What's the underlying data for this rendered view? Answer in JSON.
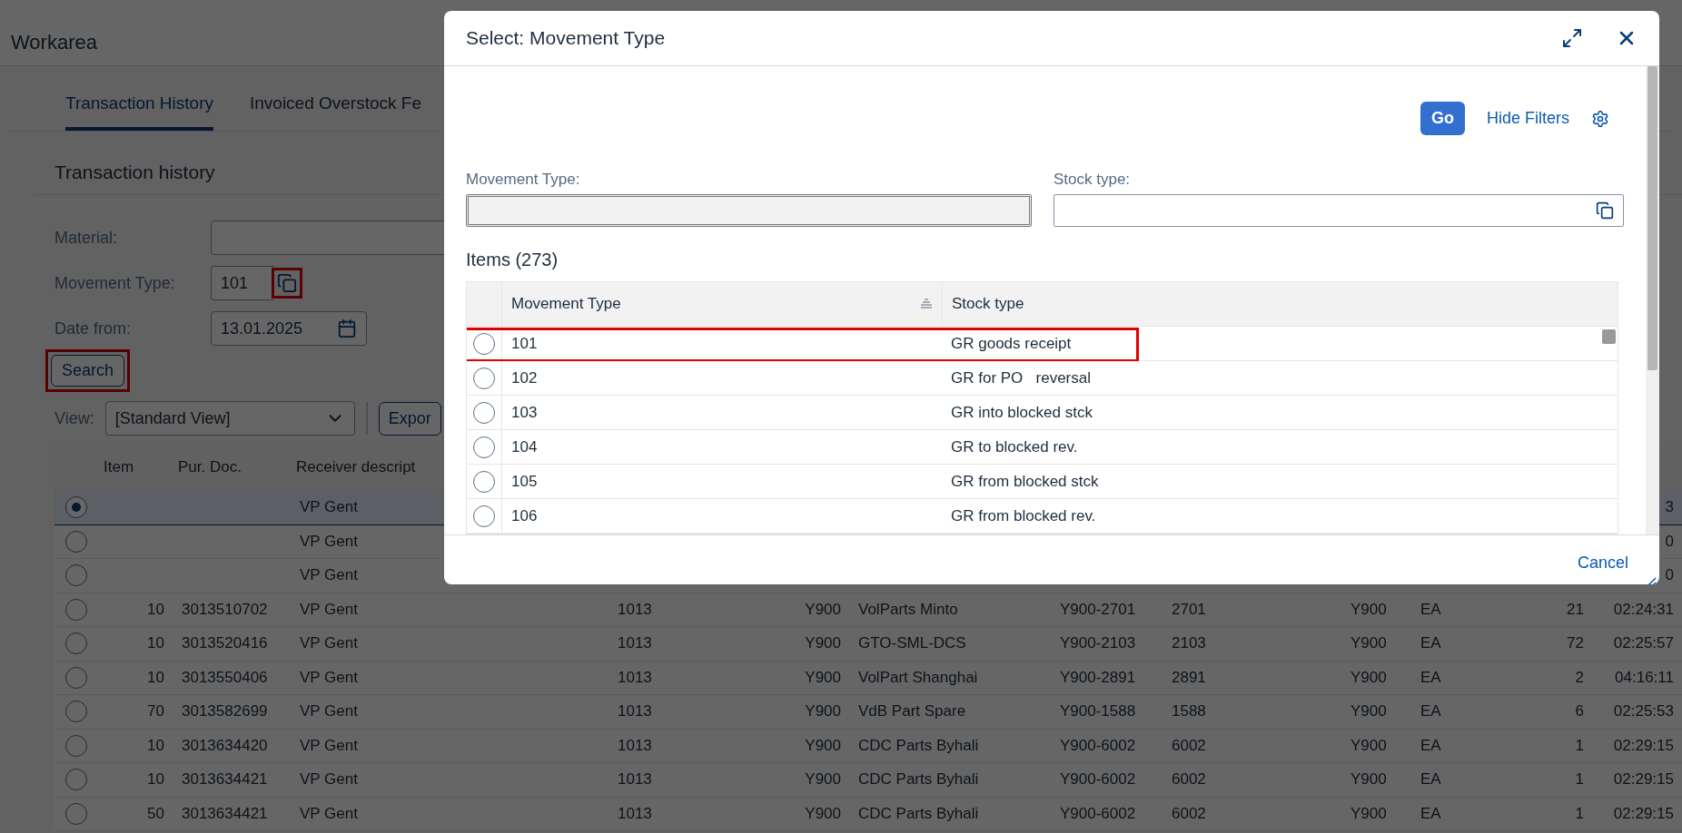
{
  "page": {
    "title": "Workarea"
  },
  "tabs": [
    {
      "label": "Transaction History",
      "selected": true
    },
    {
      "label": "Invoiced Overstock Fe",
      "selected": false
    }
  ],
  "section": {
    "title": "Transaction history"
  },
  "filters": {
    "material": {
      "label": "Material:"
    },
    "movement_type": {
      "label": "Movement Type:",
      "value": "101",
      "highlighted": true
    },
    "date_from": {
      "label": "Date from:",
      "value": "13.01.2025"
    }
  },
  "search_button": {
    "label": "Search",
    "highlighted": true
  },
  "view": {
    "label": "View:",
    "value": "[Standard View]"
  },
  "export_button": "Expor",
  "table": {
    "columns": [
      "Item",
      "Pur. Doc.",
      "Receiver descript"
    ],
    "rows": [
      {
        "selected": true,
        "receiver": "VP Gent",
        "column_12": "3"
      },
      {
        "selected": false,
        "receiver": "VP Gent",
        "column_12": "0"
      },
      {
        "selected": false,
        "receiver": "VP Gent",
        "column_12": "0"
      },
      {
        "selected": false,
        "item": "10",
        "pur_doc": "3013510702",
        "receiver": "VP Gent",
        "column_4": "1013",
        "column_5": "Y900",
        "column_6": "VolParts Minto",
        "column_7": "Y900-2701",
        "column_8": "2701",
        "column_9": "Y900",
        "column_10": "EA",
        "column_11": "21",
        "column_12": "02:24:31"
      },
      {
        "selected": false,
        "item": "10",
        "pur_doc": "3013520416",
        "receiver": "VP Gent",
        "column_4": "1013",
        "column_5": "Y900",
        "column_6": "GTO-SML-DCS",
        "column_7": "Y900-2103",
        "column_8": "2103",
        "column_9": "Y900",
        "column_10": "EA",
        "column_11": "72",
        "column_12": "02:25:57"
      },
      {
        "selected": false,
        "item": "10",
        "pur_doc": "3013550406",
        "receiver": "VP Gent",
        "column_4": "1013",
        "column_5": "Y900",
        "column_6": "VolPart Shanghai",
        "column_7": "Y900-2891",
        "column_8": "2891",
        "column_9": "Y900",
        "column_10": "EA",
        "column_11": "2",
        "column_12": "04:16:11"
      },
      {
        "selected": false,
        "item": "70",
        "pur_doc": "3013582699",
        "receiver": "VP Gent",
        "column_4": "1013",
        "column_5": "Y900",
        "column_6": "VdB Part Spare",
        "column_7": "Y900-1588",
        "column_8": "1588",
        "column_9": "Y900",
        "column_10": "EA",
        "column_11": "6",
        "column_12": "02:25:53"
      },
      {
        "selected": false,
        "item": "10",
        "pur_doc": "3013634420",
        "receiver": "VP Gent",
        "column_4": "1013",
        "column_5": "Y900",
        "column_6": "CDC Parts Byhali",
        "column_7": "Y900-6002",
        "column_8": "6002",
        "column_9": "Y900",
        "column_10": "EA",
        "column_11": "1",
        "column_12": "02:29:15"
      },
      {
        "selected": false,
        "item": "10",
        "pur_doc": "3013634421",
        "receiver": "VP Gent",
        "column_4": "1013",
        "column_5": "Y900",
        "column_6": "CDC Parts Byhali",
        "column_7": "Y900-6002",
        "column_8": "6002",
        "column_9": "Y900",
        "column_10": "EA",
        "column_11": "1",
        "column_12": "02:29:15"
      },
      {
        "selected": false,
        "item": "50",
        "pur_doc": "3013634421",
        "receiver": "VP Gent",
        "column_4": "1013",
        "column_5": "Y900",
        "column_6": "CDC Parts Byhali",
        "column_7": "Y900-6002",
        "column_8": "6002",
        "column_9": "Y900",
        "column_10": "EA",
        "column_11": "1",
        "column_12": "02:29:15"
      }
    ]
  },
  "dialog": {
    "title": "Select: Movement Type",
    "go_button": "Go",
    "hide_filters_link": "Hide Filters",
    "filters": [
      {
        "label": "Movement Type:",
        "disabled": true
      },
      {
        "label": "Stock type:",
        "disabled": false
      }
    ],
    "items_title": "Items (273)",
    "columns": [
      "Movement Type",
      "Stock type"
    ],
    "rows": [
      {
        "movement_type": "101",
        "stock_type": "GR goods receipt",
        "selected": false,
        "highlighted": true
      },
      {
        "movement_type": "102",
        "stock_type": "GR for PO   reversal",
        "selected": false,
        "highlighted": false
      },
      {
        "movement_type": "103",
        "stock_type": "GR into blocked stck",
        "selected": false,
        "highlighted": false
      },
      {
        "movement_type": "104",
        "stock_type": "GR to blocked rev.",
        "selected": false,
        "highlighted": false
      },
      {
        "movement_type": "105",
        "stock_type": "GR from blocked stck",
        "selected": false,
        "highlighted": false
      },
      {
        "movement_type": "106",
        "stock_type": "GR from blocked rev.",
        "selected": false,
        "highlighted": false
      }
    ],
    "cancel_button": "Cancel"
  }
}
